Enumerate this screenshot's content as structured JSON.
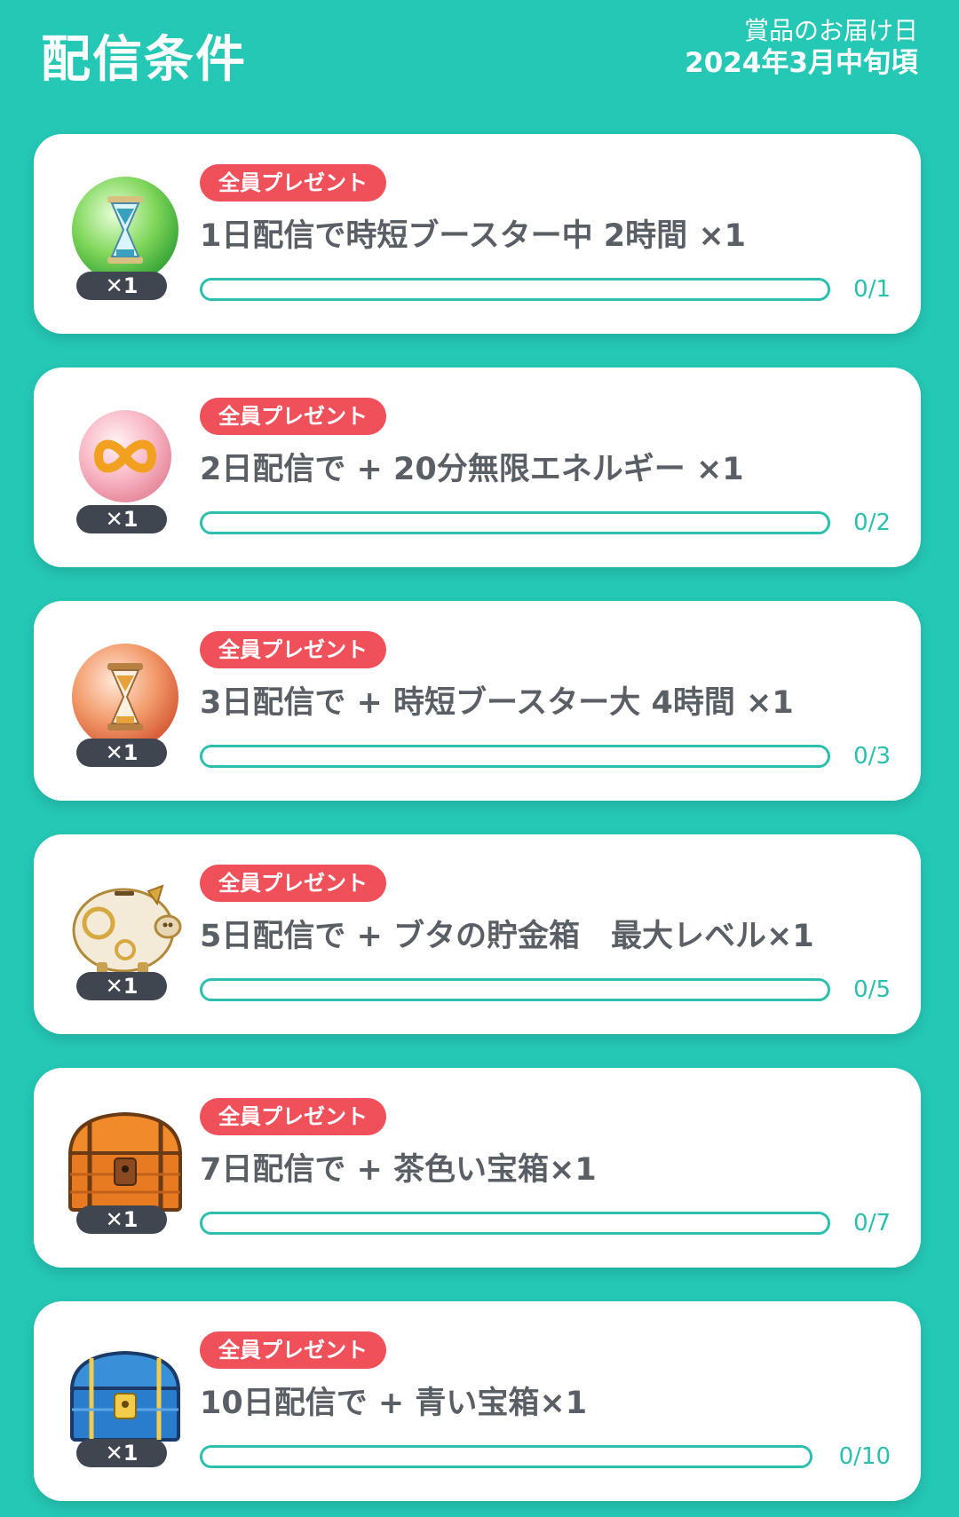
{
  "header": {
    "title": "配信条件",
    "delivery_label": "賞品のお届け日",
    "delivery_date": "2024年3月中旬頃"
  },
  "colors": {
    "background": "#25c7b5",
    "accent": "#2ac0ad",
    "tag": "#f0505a",
    "badge": "#3f4650"
  },
  "rewards": [
    {
      "icon": "hourglass-green-icon",
      "qty": "✕1",
      "tag": "全員プレゼント",
      "condition": "1日配信で時短ブースター中 2時間 ×1",
      "progress": 0,
      "count": "0/1"
    },
    {
      "icon": "infinity-energy-icon",
      "qty": "✕1",
      "tag": "全員プレゼント",
      "condition": "2日配信で +  20分無限エネルギー ×1",
      "progress": 0,
      "count": "0/2"
    },
    {
      "icon": "hourglass-orange-icon",
      "qty": "✕1",
      "tag": "全員プレゼント",
      "condition": "3日配信で + 時短ブースター大 4時間 ×1",
      "progress": 0,
      "count": "0/3"
    },
    {
      "icon": "piggy-bank-icon",
      "qty": "✕1",
      "tag": "全員プレゼント",
      "condition": "5日配信で + ブタの貯金箱　最大レベル×1",
      "progress": 0,
      "count": "0/5"
    },
    {
      "icon": "brown-chest-icon",
      "qty": "✕1",
      "tag": "全員プレゼント",
      "condition": "7日配信で + 茶色い宝箱×1",
      "progress": 0,
      "count": "0/7"
    },
    {
      "icon": "blue-chest-icon",
      "qty": "✕1",
      "tag": "全員プレゼント",
      "condition": "10日配信で + 青い宝箱×1",
      "progress": 0,
      "count": "0/10"
    }
  ]
}
